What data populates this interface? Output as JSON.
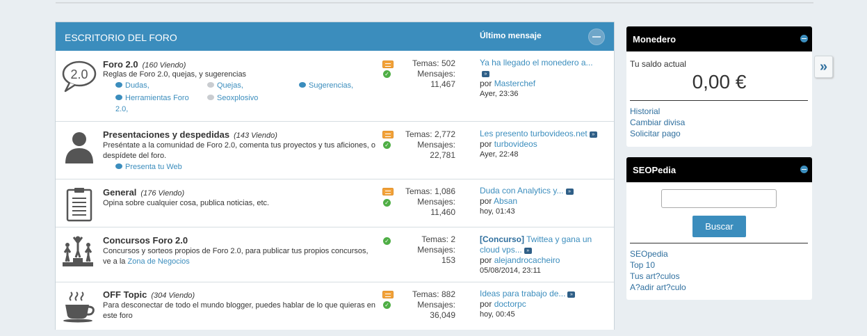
{
  "forum": {
    "title": "ESCRITORIO DEL FORO",
    "last_post_header": "Último mensaje",
    "rows": [
      {
        "name": "Foro 2.0",
        "viewing": "(160 Viendo)",
        "description": "Reglas de Foro 2.0, quejas, y sugerencias",
        "subforums": [
          "Dudas,",
          "Quejas,",
          "Sugerencias,",
          "Herramientas Foro 2.0,",
          "Seoxplosivo"
        ],
        "stats": {
          "topics": "Temas: 502",
          "posts_label": "Mensajes:",
          "posts": "11,467"
        },
        "last": {
          "title": "Ya ha llegado el monedero a...",
          "by": "por",
          "user": "Masterchef",
          "time": "Ayer, 23:36"
        }
      },
      {
        "name": "Presentaciones y despedidas",
        "viewing": "(143 Viendo)",
        "description": "Preséntate a la comunidad de Foro 2.0, comenta tus proyectos y tus aficiones, o despídete del foro.",
        "subforums": [
          "Presenta tu Web"
        ],
        "stats": {
          "topics": "Temas: 2,772",
          "posts_label": "Mensajes:",
          "posts": "22,781"
        },
        "last": {
          "title": "Les presento turbovideos.net",
          "by": "por",
          "user": "turbovideos",
          "time": "Ayer, 22:48"
        }
      },
      {
        "name": "General",
        "viewing": "(176 Viendo)",
        "description": "Opina sobre cualquier cosa, publica noticias, etc.",
        "subforums": [],
        "stats": {
          "topics": "Temas: 1,086",
          "posts_label": "Mensajes:",
          "posts": "11,460"
        },
        "last": {
          "title": "Duda con Analytics y...",
          "by": "por",
          "user": "Absan",
          "time": "hoy, 01:43"
        }
      },
      {
        "name": "Concursos Foro 2.0",
        "viewing": "",
        "description": "Concursos y sorteos propios de Foro 2.0, para publicar tus propios concursos, ve a la",
        "description_link": "Zona de Negocios",
        "subforums": [],
        "stats": {
          "topics": "Temas: 2",
          "posts_label": "Mensajes:",
          "posts": "153"
        },
        "last": {
          "prefix": "[Concurso]",
          "title": "Twittea y gana un cloud vps...",
          "by": "por",
          "user": "alejandrocacheiro",
          "time": "05/08/2014, 23:11"
        }
      },
      {
        "name": "OFF Topic",
        "viewing": "(304 Viendo)",
        "description": "Para desconectar de todo el mundo blogger, puedes hablar de lo que quieras en este foro",
        "subforums": [],
        "stats": {
          "topics": "Temas: 882",
          "posts_label": "Mensajes:",
          "posts": "36,049"
        },
        "last": {
          "title": "Ideas para trabajo de...",
          "by": "por",
          "user": "doctorpc",
          "time": "hoy, 00:45"
        }
      }
    ]
  },
  "wallet": {
    "title": "Monedero",
    "balance_label": "Tu saldo actual",
    "balance": "0,00 €",
    "links": [
      "Historial",
      "Cambiar divisa",
      "Solicitar pago"
    ]
  },
  "seopedia": {
    "title": "SEOPedia",
    "search_button": "Buscar",
    "links": [
      "SEOpedia",
      "Top 10",
      "Tus art?culos",
      "A?adir art?culo"
    ]
  },
  "side_toggle": "»",
  "icon_label": "2.0",
  "colors": {
    "accent": "#3b8dbd",
    "header_bg": "#3b8dbd",
    "panel_header": "#000000",
    "page_bg": "#e9eef2"
  }
}
